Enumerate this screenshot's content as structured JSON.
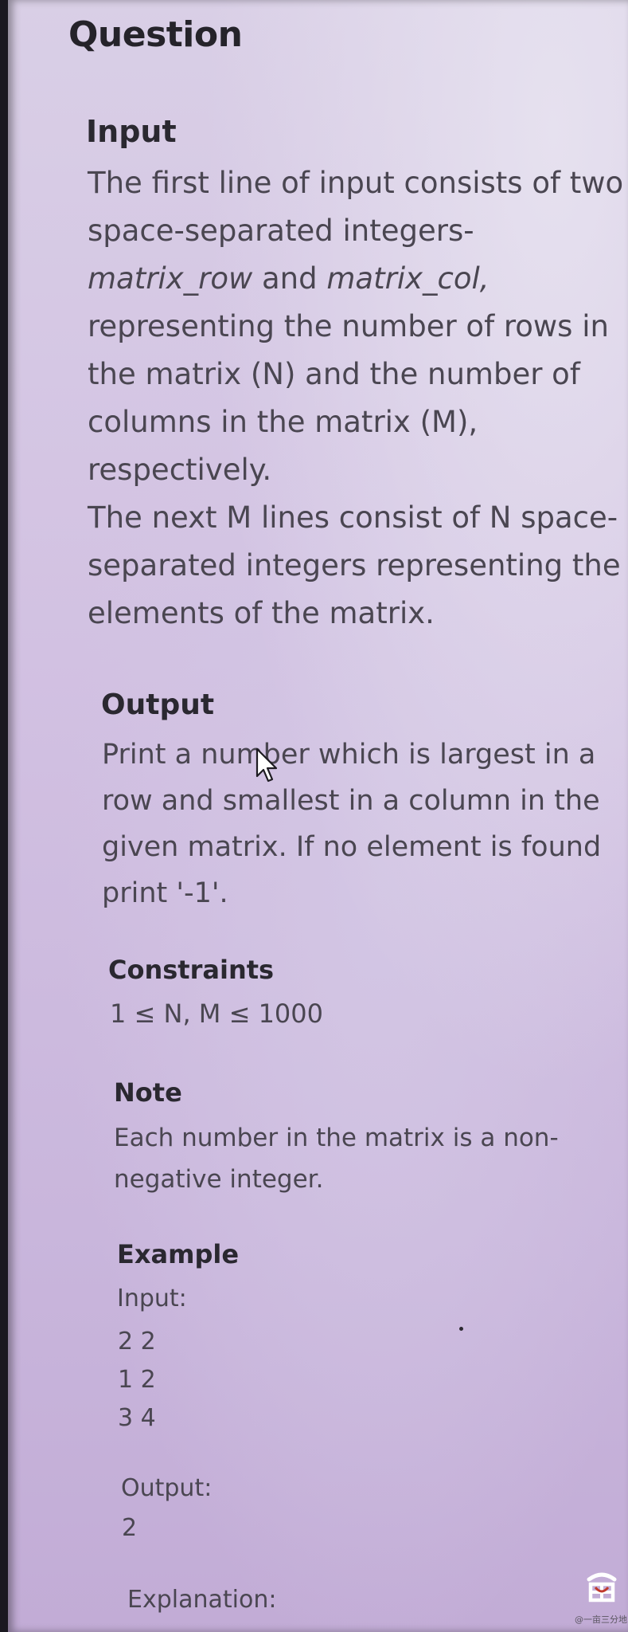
{
  "question": {
    "title": "Question"
  },
  "input_section": {
    "title": "Input",
    "lines": [
      "The first line of input consists of two",
      "space-separated integers-",
      "representing the number of rows in",
      "the matrix (N) and the number of",
      "columns in the matrix (M),",
      "respectively.",
      "The next M lines consist of N space-",
      "separated integers representing the",
      "elements of the matrix."
    ],
    "var_row": "matrix_row",
    "and_word": "and",
    "var_col": "matrix_col,"
  },
  "output_section": {
    "title": "Output",
    "lines": [
      "Print a number which is largest in a",
      "row and smallest in a column in the",
      "given matrix. If no element is found",
      "print '-1'."
    ]
  },
  "constraints_section": {
    "title": "Constraints",
    "text": "1 ≤ N, M ≤ 1000"
  },
  "note_section": {
    "title": "Note",
    "lines": [
      "Each number in the matrix is a non-",
      "negative integer."
    ]
  },
  "example_section": {
    "title": "Example",
    "input_label": "Input:",
    "input_lines": [
      "2 2",
      "1 2",
      "3 4"
    ],
    "output_label": "Output:",
    "output_value": "2",
    "explanation_label": "Explanation:"
  },
  "watermark": {
    "logo_icon": "fish-logo-icon",
    "text": "@一亩三分地"
  }
}
